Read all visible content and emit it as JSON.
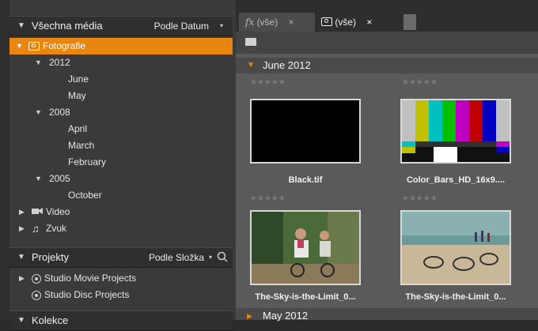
{
  "library": {
    "header": {
      "title": "Všechna média",
      "sort_label": "Podle Datum",
      "dropdown": "▾"
    },
    "tree": [
      {
        "label": "Fotografie",
        "icon": "camera-icon",
        "selected": true
      },
      {
        "label": "2012"
      },
      {
        "label": "June"
      },
      {
        "label": "May"
      },
      {
        "label": "2008"
      },
      {
        "label": "April"
      },
      {
        "label": "March"
      },
      {
        "label": "February"
      },
      {
        "label": "2005"
      },
      {
        "label": "October"
      },
      {
        "label": "Video",
        "icon": "video-camera-icon"
      },
      {
        "label": "Zvuk",
        "icon": "music-note-icon"
      }
    ]
  },
  "projects": {
    "header": {
      "title": "Projekty",
      "sort_label": "Podle Složka",
      "dropdown": "▾"
    },
    "items": [
      {
        "label": "Studio Movie Projects",
        "icon": "film-reel-icon"
      },
      {
        "label": "Studio Disc Projects",
        "icon": "disc-icon"
      }
    ]
  },
  "collections": {
    "header": {
      "title": "Kolekce"
    }
  },
  "tabs": [
    {
      "label": "(vše)",
      "prefix": "fx",
      "close": "×"
    },
    {
      "label": "(vše)",
      "prefix": "camera",
      "close": "×",
      "active": true
    }
  ],
  "groups": [
    {
      "label": "June 2012",
      "items": [
        {
          "caption": "Black.tif",
          "stars": "★★★★★"
        },
        {
          "caption": "Color_Bars_HD_16x9....",
          "stars": "★★★★★"
        },
        {
          "caption": "The-Sky-is-the-Limit_0...",
          "stars": "★★★★★"
        },
        {
          "caption": "The-Sky-is-the-Limit_0...",
          "stars": "★★★★★"
        }
      ]
    },
    {
      "label": "May 2012"
    }
  ],
  "colors": {
    "accent": "#e8860f",
    "panel": "#3a3a3a",
    "browser_bg": "#5a5a5a"
  }
}
